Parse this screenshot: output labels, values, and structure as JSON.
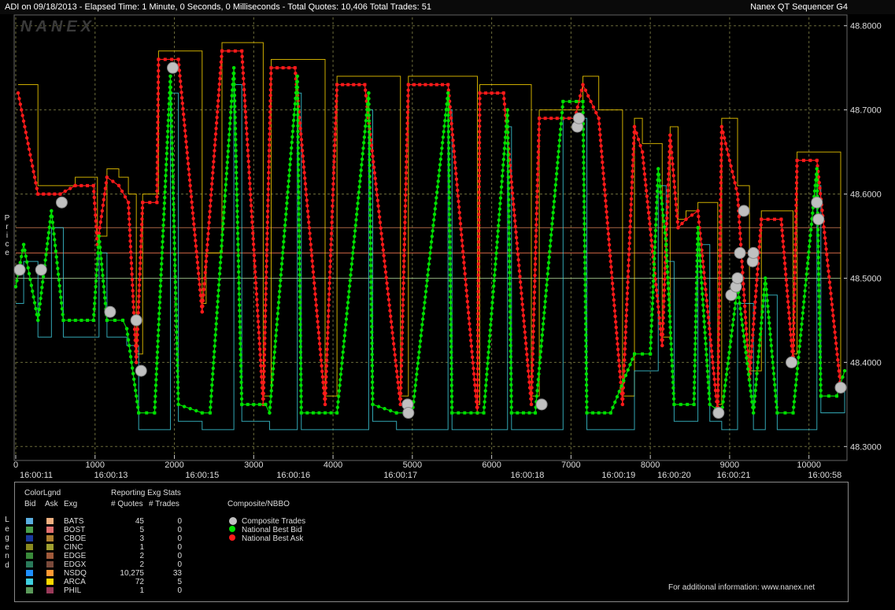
{
  "header": {
    "title": "ADI on 09/18/2013  -  Elapsed Time: 1 Minute, 0 Seconds, 0 Milliseconds  -  Total Quotes: 10,406  Total Trades: 51",
    "app": "Nanex QT Sequencer G4",
    "watermark": "NANEX"
  },
  "axis_side_labels": {
    "y": "Price",
    "legend": "Legend"
  },
  "colors": {
    "bid": "#00e000",
    "ask": "#ff1a1a",
    "trade": "#c0c0c0",
    "grid": "#6a6a3a",
    "frame": "#666666",
    "nsdq_bid": "#1e90ff",
    "nsdq_ask": "#ff9933",
    "arca_bid": "#3fd0e0",
    "arca_ask": "#ffd700"
  },
  "chart_data": {
    "type": "line",
    "ylim": [
      48.29,
      48.81
    ],
    "xlim": [
      0,
      10400
    ],
    "yticks": [
      "48.8000",
      "48.7000",
      "48.6000",
      "48.5000",
      "48.4000",
      "48.3000"
    ],
    "ytick_values": [
      48.8,
      48.7,
      48.6,
      48.5,
      48.4,
      48.3
    ],
    "xticks": [
      "0",
      "1000",
      "2000",
      "3000",
      "4000",
      "5000",
      "6000",
      "7000",
      "8000",
      "9000",
      "10000"
    ],
    "xtick_values": [
      0,
      1000,
      2000,
      3000,
      4000,
      5000,
      6000,
      7000,
      8000,
      9000,
      10000
    ],
    "time_labels": [
      {
        "x": 0,
        "t": "16:00:11"
      },
      {
        "x": 1200,
        "t": "16:00:13"
      },
      {
        "x": 2350,
        "t": "16:00:15"
      },
      {
        "x": 3500,
        "t": "16:00:16"
      },
      {
        "x": 4850,
        "t": "16:00:17"
      },
      {
        "x": 6450,
        "t": "16:00:18"
      },
      {
        "x": 7600,
        "t": "16:00:19"
      },
      {
        "x": 8300,
        "t": "16:00:20"
      },
      {
        "x": 9050,
        "t": "16:00:21"
      },
      {
        "x": 10200,
        "t": "16:00:58"
      }
    ],
    "series": [
      {
        "name": "National Best Ask",
        "color": "#ff1a1a",
        "points": [
          [
            30,
            48.72
          ],
          [
            280,
            48.6
          ],
          [
            560,
            48.6
          ],
          [
            750,
            48.61
          ],
          [
            980,
            48.61
          ],
          [
            1030,
            48.54
          ],
          [
            1150,
            48.62
          ],
          [
            1300,
            48.61
          ],
          [
            1420,
            48.59
          ],
          [
            1520,
            48.4
          ],
          [
            1600,
            48.59
          ],
          [
            1780,
            48.59
          ],
          [
            1800,
            48.76
          ],
          [
            2050,
            48.76
          ],
          [
            2350,
            48.46
          ],
          [
            2400,
            48.52
          ],
          [
            2600,
            48.77
          ],
          [
            2850,
            48.77
          ],
          [
            3120,
            48.35
          ],
          [
            3220,
            48.75
          ],
          [
            3520,
            48.75
          ],
          [
            3900,
            48.35
          ],
          [
            4050,
            48.73
          ],
          [
            4400,
            48.73
          ],
          [
            4850,
            48.35
          ],
          [
            4950,
            48.73
          ],
          [
            5450,
            48.73
          ],
          [
            5820,
            48.34
          ],
          [
            5850,
            48.72
          ],
          [
            6150,
            48.72
          ],
          [
            6500,
            48.35
          ],
          [
            6600,
            48.69
          ],
          [
            7050,
            48.69
          ],
          [
            7150,
            48.73
          ],
          [
            7350,
            48.69
          ],
          [
            7650,
            48.35
          ],
          [
            7800,
            48.68
          ],
          [
            7900,
            48.65
          ],
          [
            8150,
            48.42
          ],
          [
            8250,
            48.67
          ],
          [
            8350,
            48.56
          ],
          [
            8450,
            48.57
          ],
          [
            8600,
            48.58
          ],
          [
            8850,
            48.34
          ],
          [
            8900,
            48.68
          ],
          [
            9100,
            48.6
          ],
          [
            9250,
            48.38
          ],
          [
            9400,
            48.57
          ],
          [
            9650,
            48.57
          ],
          [
            9800,
            48.4
          ],
          [
            9850,
            48.64
          ],
          [
            10100,
            48.64
          ],
          [
            10400,
            48.37
          ]
        ]
      },
      {
        "name": "National Best Bid",
        "color": "#00e000",
        "points": [
          [
            0,
            48.49
          ],
          [
            100,
            48.54
          ],
          [
            280,
            48.45
          ],
          [
            450,
            48.58
          ],
          [
            600,
            48.45
          ],
          [
            980,
            48.45
          ],
          [
            1050,
            48.55
          ],
          [
            1150,
            48.45
          ],
          [
            1350,
            48.45
          ],
          [
            1400,
            48.44
          ],
          [
            1550,
            48.34
          ],
          [
            1750,
            48.34
          ],
          [
            1950,
            48.74
          ],
          [
            2050,
            48.35
          ],
          [
            2350,
            48.34
          ],
          [
            2450,
            48.34
          ],
          [
            2750,
            48.75
          ],
          [
            2850,
            48.35
          ],
          [
            3150,
            48.35
          ],
          [
            3200,
            48.34
          ],
          [
            3550,
            48.74
          ],
          [
            3600,
            48.34
          ],
          [
            4050,
            48.34
          ],
          [
            4450,
            48.72
          ],
          [
            4500,
            48.35
          ],
          [
            4800,
            48.34
          ],
          [
            5000,
            48.34
          ],
          [
            5450,
            48.72
          ],
          [
            5500,
            48.34
          ],
          [
            5900,
            48.34
          ],
          [
            6200,
            48.7
          ],
          [
            6250,
            48.34
          ],
          [
            6550,
            48.34
          ],
          [
            6900,
            48.71
          ],
          [
            7150,
            48.71
          ],
          [
            7200,
            48.34
          ],
          [
            7500,
            48.34
          ],
          [
            7800,
            48.41
          ],
          [
            8000,
            48.41
          ],
          [
            8100,
            48.63
          ],
          [
            8200,
            48.54
          ],
          [
            8300,
            48.35
          ],
          [
            8550,
            48.35
          ],
          [
            8600,
            48.56
          ],
          [
            8750,
            48.35
          ],
          [
            8900,
            48.34
          ],
          [
            9100,
            48.49
          ],
          [
            9300,
            48.34
          ],
          [
            9450,
            48.5
          ],
          [
            9600,
            48.34
          ],
          [
            9800,
            48.34
          ],
          [
            10100,
            48.63
          ],
          [
            10150,
            48.36
          ],
          [
            10350,
            48.36
          ],
          [
            10450,
            48.39
          ]
        ]
      }
    ],
    "composite_trades": [
      [
        50,
        48.51
      ],
      [
        320,
        48.51
      ],
      [
        580,
        48.59
      ],
      [
        1190,
        48.46
      ],
      [
        1520,
        48.45
      ],
      [
        1580,
        48.39
      ],
      [
        1980,
        48.75
      ],
      [
        4940,
        48.35
      ],
      [
        4950,
        48.34
      ],
      [
        6630,
        48.35
      ],
      [
        7080,
        48.68
      ],
      [
        7100,
        48.69
      ],
      [
        8860,
        48.34
      ],
      [
        9020,
        48.48
      ],
      [
        9080,
        48.49
      ],
      [
        9100,
        48.5
      ],
      [
        9130,
        48.53
      ],
      [
        9180,
        48.58
      ],
      [
        9290,
        48.52
      ],
      [
        9300,
        48.53
      ],
      [
        9780,
        48.4
      ],
      [
        10100,
        48.59
      ],
      [
        10120,
        48.57
      ],
      [
        10400,
        48.37
      ]
    ],
    "hlines": [
      {
        "y": 48.5,
        "color": "#8aa87a"
      },
      {
        "y": 48.53,
        "color": "#cc6644"
      },
      {
        "y": 48.56,
        "color": "#aa6644"
      }
    ],
    "title": "",
    "xlabel": "",
    "ylabel": "Price"
  },
  "legend": {
    "colorlgnd_label": "ColorLgnd",
    "reporting_label": "Reporting Exg Stats",
    "headers": {
      "bid": "Bid",
      "ask": "Ask",
      "exg": "Exg",
      "quotes": "# Quotes",
      "trades": "# Trades"
    },
    "rows": [
      {
        "exg": "BATS",
        "bid": "#5aaee0",
        "ask": "#f0b080",
        "quotes": "45",
        "trades": "0"
      },
      {
        "exg": "BOST",
        "bid": "#4aa04a",
        "ask": "#e07070",
        "quotes": "5",
        "trades": "0"
      },
      {
        "exg": "CBOE",
        "bid": "#1a3aa0",
        "ask": "#b08030",
        "quotes": "3",
        "trades": "0"
      },
      {
        "exg": "CINC",
        "bid": "#8a8a20",
        "ask": "#a0a030",
        "quotes": "1",
        "trades": "0"
      },
      {
        "exg": "EDGE",
        "bid": "#3a8a3a",
        "ask": "#a05a3a",
        "quotes": "2",
        "trades": "0"
      },
      {
        "exg": "EDGX",
        "bid": "#2a7a5a",
        "ask": "#7a4a3a",
        "quotes": "2",
        "trades": "0"
      },
      {
        "exg": "NSDQ",
        "bid": "#1e90ff",
        "ask": "#ff9933",
        "quotes": "10,275",
        "trades": "33"
      },
      {
        "exg": "ARCA",
        "bid": "#3fd0e0",
        "ask": "#ffd700",
        "quotes": "72",
        "trades": "5"
      },
      {
        "exg": "PHIL",
        "bid": "#5a9a5a",
        "ask": "#9a3a5a",
        "quotes": "1",
        "trades": "0"
      }
    ],
    "composite": {
      "title": "Composite/NBBO",
      "items": [
        {
          "label": "Composite Trades",
          "color": "#c0c0c0"
        },
        {
          "label": "National Best Bid",
          "color": "#00e000"
        },
        {
          "label": "National Best Ask",
          "color": "#ff1a1a"
        }
      ]
    },
    "footer": "For additional information: www.nanex.net"
  }
}
